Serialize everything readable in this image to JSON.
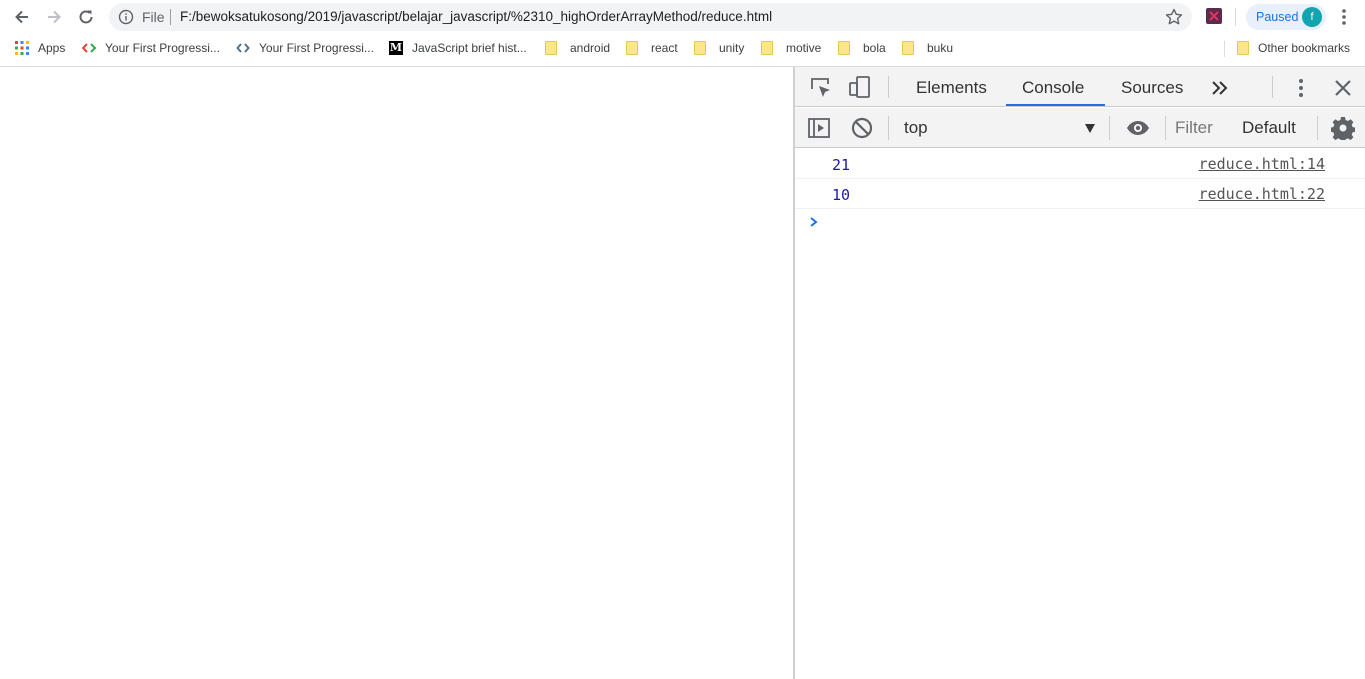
{
  "browser": {
    "address": {
      "scheme_label": "File",
      "url": "F:/bewoksatukosong/2019/javascript/belajar_javascript/%2310_highOrderArrayMethod/reduce.html"
    },
    "profile": {
      "status": "Paused",
      "avatar_letter": "f"
    }
  },
  "bookmarks": {
    "items": [
      {
        "label": "Apps",
        "icon": "apps-grid-icon"
      },
      {
        "label": "Your First Progressi...",
        "icon": "code-brackets-icon"
      },
      {
        "label": "Your First Progressi...",
        "icon": "code-brackets-icon"
      },
      {
        "label": "JavaScript brief hist...",
        "icon": "medium-m-icon"
      },
      {
        "label": "android",
        "icon": "folder-icon"
      },
      {
        "label": "react",
        "icon": "folder-icon"
      },
      {
        "label": "unity",
        "icon": "folder-icon"
      },
      {
        "label": "motive",
        "icon": "folder-icon"
      },
      {
        "label": "bola",
        "icon": "folder-icon"
      },
      {
        "label": "buku",
        "icon": "folder-icon"
      }
    ],
    "other": "Other bookmarks"
  },
  "devtools": {
    "tabs": [
      "Elements",
      "Console",
      "Sources"
    ],
    "active_tab": "Console",
    "context": "top",
    "filter_placeholder": "Filter",
    "levels": "Default",
    "messages": [
      {
        "value": "21",
        "source": "reduce.html:14"
      },
      {
        "value": "10",
        "source": "reduce.html:22"
      }
    ]
  },
  "colors": {
    "accent": "#1a73e8",
    "console_number": "#1a1aa6",
    "avatar": "#12a4af"
  }
}
